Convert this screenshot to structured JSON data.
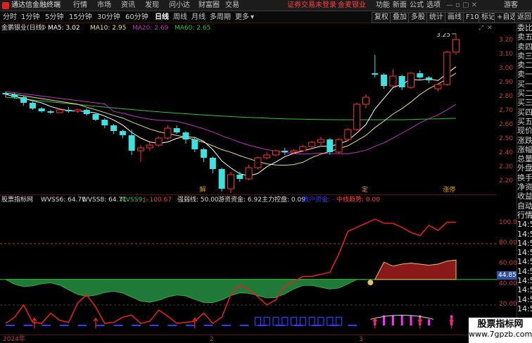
{
  "topbar": {
    "app_title": "通达信金融终端",
    "menu": [
      "行情",
      "市场",
      "资讯",
      "发现",
      "问小达",
      "财富圈",
      "交易"
    ],
    "promo": "证券交易未登录",
    "product": "金麦银业",
    "right": [
      "功能",
      "新面",
      "公式",
      "选项"
    ],
    "visitor": "游客"
  },
  "toolbar": {
    "periods": [
      "分时",
      "1分钟",
      "5分钟",
      "15分钟",
      "30分钟",
      "60分钟",
      "日线",
      "周线",
      "月线",
      "多周期",
      "更多"
    ],
    "active_period": "日线",
    "right_buttons": [
      "复权",
      "叠加",
      "多股",
      "统计",
      "画线",
      "F10",
      "标记",
      "+自选",
      "返回"
    ]
  },
  "ma_line": {
    "name": "金鹏银业(日线)",
    "ma5": "MA5: 3.02",
    "ma10": "MA10: 2.95",
    "ma20": "MA20: 2.69",
    "ma60": "MA60: 2.65"
  },
  "main_axis": [
    "3.20",
    "3.10",
    "3.00",
    "2.90",
    "2.80",
    "2.70",
    "2.60",
    "2.50",
    "2.40",
    "2.30",
    "2.20"
  ],
  "annotations": {
    "high": "3.25",
    "low": "2.05",
    "mark1": "解",
    "mark2": "定",
    "mark3": "涨停"
  },
  "indicator": {
    "name": "股票指标网",
    "wvss6": "WVSS6: 64.71",
    "wvss8": "WVSS8: 64.71",
    "wvss9": "WVSS9: -",
    "j": "J: 100.67",
    "strong": "强弱线: 50.00",
    "float": "游资资金: 6.92",
    "main": "主力控盘: 0.09",
    "retail": "散户资金: -",
    "mid": "中线趋势: 0.00"
  },
  "ind_axis": [
    "100.0",
    "80.00",
    "60.00",
    "40.00",
    "20.00"
  ],
  "ind_cursor": "44.85",
  "xaxis": {
    "year": "2024年",
    "m2": "2",
    "m3": "3"
  },
  "side_panel": [
    "委比",
    "卖五",
    "卖四",
    "卖三",
    "卖二",
    "卖一",
    "买一",
    "买二",
    "买三",
    "买四",
    "买五",
    "现价",
    "涨跌",
    "涨幅",
    "总量",
    "外盘",
    "换手",
    "净资",
    "收益",
    "自动",
    "行情",
    "14:56",
    "14:56",
    "14:56",
    "14:56",
    "14:56",
    "14:56",
    "14:56",
    "14:57",
    "14:57",
    "14:57"
  ],
  "watermark": {
    "title": "股票指标网",
    "url": "www.7gpzb.com"
  },
  "colors": {
    "up": "#ff3030",
    "down": "#40e0e0",
    "ma5": "#ffffff",
    "ma10": "#e8e070",
    "ma20": "#c030c0",
    "ma60": "#30c030",
    "indicator_red": "#e02020",
    "fill_green": "#1f7a3a",
    "fill_red": "#8a1a1a",
    "blue": "#2040ff",
    "magenta": "#ff30ff"
  },
  "candles": [
    [
      2.83,
      2.84,
      2.8,
      2.82
    ],
    [
      2.82,
      2.83,
      2.79,
      2.8
    ],
    [
      2.8,
      2.81,
      2.74,
      2.76
    ],
    [
      2.76,
      2.77,
      2.71,
      2.72
    ],
    [
      2.72,
      2.73,
      2.69,
      2.7
    ],
    [
      2.7,
      2.71,
      2.68,
      2.69
    ],
    [
      2.69,
      2.72,
      2.69,
      2.71
    ],
    [
      2.71,
      2.73,
      2.69,
      2.7
    ],
    [
      2.7,
      2.72,
      2.69,
      2.71
    ],
    [
      2.71,
      2.72,
      2.67,
      2.68
    ],
    [
      2.68,
      2.69,
      2.63,
      2.64
    ],
    [
      2.64,
      2.65,
      2.58,
      2.6
    ],
    [
      2.6,
      2.61,
      2.54,
      2.56
    ],
    [
      2.56,
      2.57,
      2.51,
      2.53
    ],
    [
      2.53,
      2.57,
      2.39,
      2.42
    ],
    [
      2.42,
      2.46,
      2.34,
      2.44
    ],
    [
      2.44,
      2.48,
      2.42,
      2.46
    ],
    [
      2.46,
      2.52,
      2.45,
      2.51
    ],
    [
      2.51,
      2.6,
      2.5,
      2.58
    ],
    [
      2.58,
      2.6,
      2.54,
      2.55
    ],
    [
      2.55,
      2.56,
      2.47,
      2.5
    ],
    [
      2.5,
      2.51,
      2.41,
      2.43
    ],
    [
      2.43,
      2.44,
      2.34,
      2.37
    ],
    [
      2.37,
      2.38,
      2.26,
      2.29
    ],
    [
      2.29,
      2.3,
      2.13,
      2.15
    ],
    [
      2.15,
      2.27,
      2.05,
      2.25
    ],
    [
      2.25,
      2.27,
      2.2,
      2.22
    ],
    [
      2.22,
      2.32,
      2.21,
      2.3
    ],
    [
      2.3,
      2.38,
      2.29,
      2.37
    ],
    [
      2.37,
      2.41,
      2.36,
      2.39
    ],
    [
      2.39,
      2.43,
      2.38,
      2.42
    ],
    [
      2.42,
      2.44,
      2.39,
      2.41
    ],
    [
      2.41,
      2.43,
      2.4,
      2.42
    ],
    [
      2.42,
      2.46,
      2.41,
      2.45
    ],
    [
      2.45,
      2.49,
      2.44,
      2.48
    ],
    [
      2.48,
      2.52,
      2.45,
      2.5
    ],
    [
      2.5,
      2.51,
      2.39,
      2.41
    ],
    [
      2.41,
      2.51,
      2.4,
      2.5
    ],
    [
      2.5,
      2.58,
      2.49,
      2.57
    ],
    [
      2.57,
      2.76,
      2.56,
      2.75
    ],
    [
      2.75,
      2.82,
      2.72,
      2.8
    ],
    [
      2.97,
      3.1,
      2.94,
      2.96
    ],
    [
      2.96,
      2.97,
      2.86,
      2.88
    ],
    [
      2.88,
      3.0,
      2.87,
      2.95
    ],
    [
      2.95,
      2.96,
      2.85,
      2.87
    ],
    [
      2.87,
      2.98,
      2.86,
      2.97
    ],
    [
      2.97,
      2.99,
      2.93,
      2.94
    ],
    [
      2.94,
      2.95,
      2.9,
      2.92
    ],
    [
      2.86,
      2.9,
      2.84,
      2.89
    ],
    [
      2.89,
      3.13,
      2.88,
      3.12
    ],
    [
      3.12,
      3.25,
      3.1,
      3.21
    ]
  ]
}
